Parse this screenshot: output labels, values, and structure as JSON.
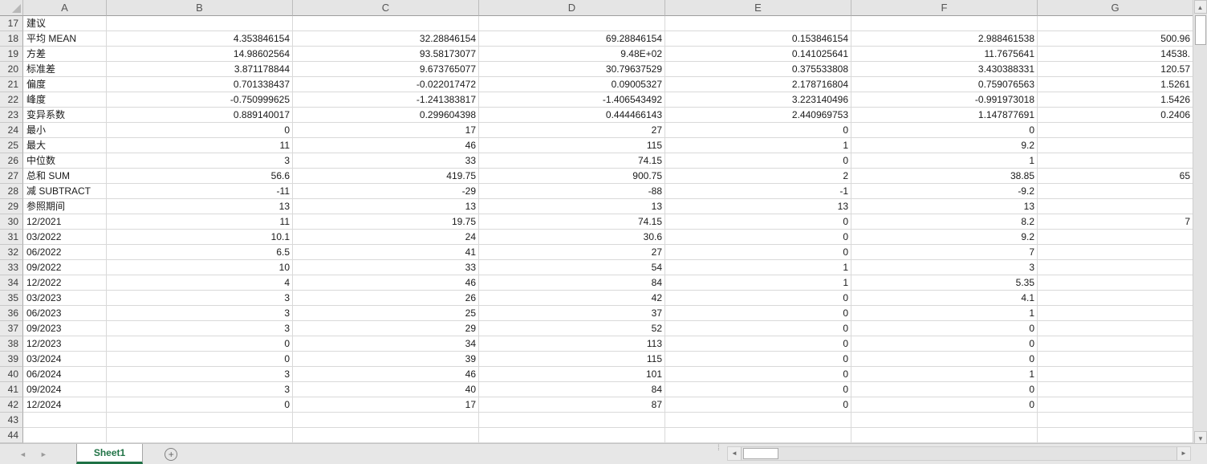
{
  "sheet": {
    "column_headers": [
      "A",
      "B",
      "C",
      "D",
      "E",
      "F",
      "G"
    ],
    "rows": [
      {
        "n": "17",
        "a": "建议",
        "b": "",
        "c": "",
        "d": "",
        "e": "",
        "f": "",
        "g": ""
      },
      {
        "n": "18",
        "a": "平均 MEAN",
        "b": "4.353846154",
        "c": "32.28846154",
        "d": "69.28846154",
        "e": "0.153846154",
        "f": "2.988461538",
        "g": "500.96"
      },
      {
        "n": "19",
        "a": "方差",
        "b": "14.98602564",
        "c": "93.58173077",
        "d": "9.48E+02",
        "e": "0.141025641",
        "f": "11.7675641",
        "g": "14538."
      },
      {
        "n": "20",
        "a": "标准差",
        "b": "3.871178844",
        "c": "9.673765077",
        "d": "30.79637529",
        "e": "0.375533808",
        "f": "3.430388331",
        "g": "120.57"
      },
      {
        "n": "21",
        "a": "偏度",
        "b": "0.701338437",
        "c": "-0.022017472",
        "d": "0.09005327",
        "e": "2.178716804",
        "f": "0.759076563",
        "g": "1.5261"
      },
      {
        "n": "22",
        "a": "峰度",
        "b": "-0.750999625",
        "c": "-1.241383817",
        "d": "-1.406543492",
        "e": "3.223140496",
        "f": "-0.991973018",
        "g": "1.5426"
      },
      {
        "n": "23",
        "a": "变异系数",
        "b": "0.889140017",
        "c": "0.299604398",
        "d": "0.444466143",
        "e": "2.440969753",
        "f": "1.147877691",
        "g": "0.2406"
      },
      {
        "n": "24",
        "a": "最小",
        "b": "0",
        "c": "17",
        "d": "27",
        "e": "0",
        "f": "0",
        "g": ""
      },
      {
        "n": "25",
        "a": "最大",
        "b": "11",
        "c": "46",
        "d": "115",
        "e": "1",
        "f": "9.2",
        "g": ""
      },
      {
        "n": "26",
        "a": "中位数",
        "b": "3",
        "c": "33",
        "d": "74.15",
        "e": "0",
        "f": "1",
        "g": ""
      },
      {
        "n": "27",
        "a": "总和 SUM",
        "b": "56.6",
        "c": "419.75",
        "d": "900.75",
        "e": "2",
        "f": "38.85",
        "g": "65"
      },
      {
        "n": "28",
        "a": "减 SUBTRACT",
        "b": "-11",
        "c": "-29",
        "d": "-88",
        "e": "-1",
        "f": "-9.2",
        "g": ""
      },
      {
        "n": "29",
        "a": "参照期间",
        "b": "13",
        "c": "13",
        "d": "13",
        "e": "13",
        "f": "13",
        "g": ""
      },
      {
        "n": "30",
        "a": "12/2021",
        "b": "11",
        "c": "19.75",
        "d": "74.15",
        "e": "0",
        "f": "8.2",
        "g": "7"
      },
      {
        "n": "31",
        "a": "03/2022",
        "b": "10.1",
        "c": "24",
        "d": "30.6",
        "e": "0",
        "f": "9.2",
        "g": ""
      },
      {
        "n": "32",
        "a": "06/2022",
        "b": "6.5",
        "c": "41",
        "d": "27",
        "e": "0",
        "f": "7",
        "g": ""
      },
      {
        "n": "33",
        "a": "09/2022",
        "b": "10",
        "c": "33",
        "d": "54",
        "e": "1",
        "f": "3",
        "g": ""
      },
      {
        "n": "34",
        "a": "12/2022",
        "b": "4",
        "c": "46",
        "d": "84",
        "e": "1",
        "f": "5.35",
        "g": ""
      },
      {
        "n": "35",
        "a": "03/2023",
        "b": "3",
        "c": "26",
        "d": "42",
        "e": "0",
        "f": "4.1",
        "g": ""
      },
      {
        "n": "36",
        "a": "06/2023",
        "b": "3",
        "c": "25",
        "d": "37",
        "e": "0",
        "f": "1",
        "g": ""
      },
      {
        "n": "37",
        "a": "09/2023",
        "b": "3",
        "c": "29",
        "d": "52",
        "e": "0",
        "f": "0",
        "g": ""
      },
      {
        "n": "38",
        "a": "12/2023",
        "b": "0",
        "c": "34",
        "d": "113",
        "e": "0",
        "f": "0",
        "g": ""
      },
      {
        "n": "39",
        "a": "03/2024",
        "b": "0",
        "c": "39",
        "d": "115",
        "e": "0",
        "f": "0",
        "g": ""
      },
      {
        "n": "40",
        "a": "06/2024",
        "b": "3",
        "c": "46",
        "d": "101",
        "e": "0",
        "f": "1",
        "g": ""
      },
      {
        "n": "41",
        "a": "09/2024",
        "b": "3",
        "c": "40",
        "d": "84",
        "e": "0",
        "f": "0",
        "g": ""
      },
      {
        "n": "42",
        "a": "12/2024",
        "b": "0",
        "c": "17",
        "d": "87",
        "e": "0",
        "f": "0",
        "g": ""
      },
      {
        "n": "43",
        "a": "",
        "b": "",
        "c": "",
        "d": "",
        "e": "",
        "f": "",
        "g": ""
      },
      {
        "n": "44",
        "a": "",
        "b": "",
        "c": "",
        "d": "",
        "e": "",
        "f": "",
        "g": ""
      }
    ]
  },
  "tabs": {
    "active": "Sheet1"
  },
  "icons": {
    "tab_prev": "◄",
    "tab_next": "►",
    "add_sheet": "+",
    "scroll_up": "▲",
    "scroll_down": "▼",
    "scroll_left": "◄",
    "scroll_right": "►",
    "splitter_dots": "⁞"
  },
  "colors": {
    "tab_active_text": "#217346",
    "tab_underline": "#1e7145",
    "header_bg": "#e5e5e5",
    "grid_line": "#d9d9d9",
    "header_text": "#555555"
  }
}
